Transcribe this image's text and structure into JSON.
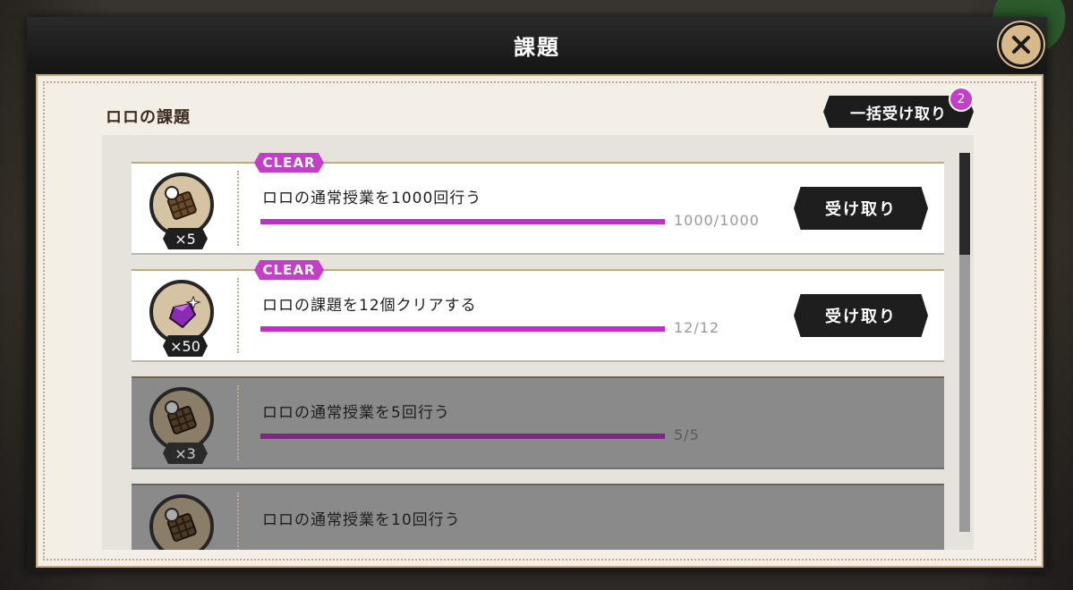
{
  "dialog": {
    "title": "課題",
    "close_icon": "close-icon"
  },
  "section": {
    "title": "ロロの課題",
    "bulk_receive_label": "一括受け取り",
    "bulk_badge_count": "2"
  },
  "tasks": [
    {
      "clear_label": "CLEAR",
      "reward_icon": "waffle-icon",
      "reward_qty": "×5",
      "name": "ロロの通常授業を1000回行う",
      "progress_text": "1000/1000",
      "progress_fraction": 1.0,
      "button_label": "受け取り",
      "state": "claimable"
    },
    {
      "clear_label": "CLEAR",
      "reward_icon": "gem-icon",
      "reward_qty": "×50",
      "name": "ロロの課題を12個クリアする",
      "progress_text": "12/12",
      "progress_fraction": 1.0,
      "button_label": "受け取り",
      "state": "claimable"
    },
    {
      "reward_icon": "waffle-icon",
      "reward_qty": "×3",
      "name": "ロロの通常授業を5回行う",
      "progress_text": "5/5",
      "progress_fraction": 1.0,
      "state": "claimed"
    },
    {
      "reward_icon": "waffle-icon",
      "name": "ロロの通常授業を10回行う",
      "state": "claimed"
    }
  ],
  "colors": {
    "accent": "#c030c8",
    "badge": "#c33fc9",
    "panel": "#f3efe6",
    "frame": "#c9a878"
  }
}
